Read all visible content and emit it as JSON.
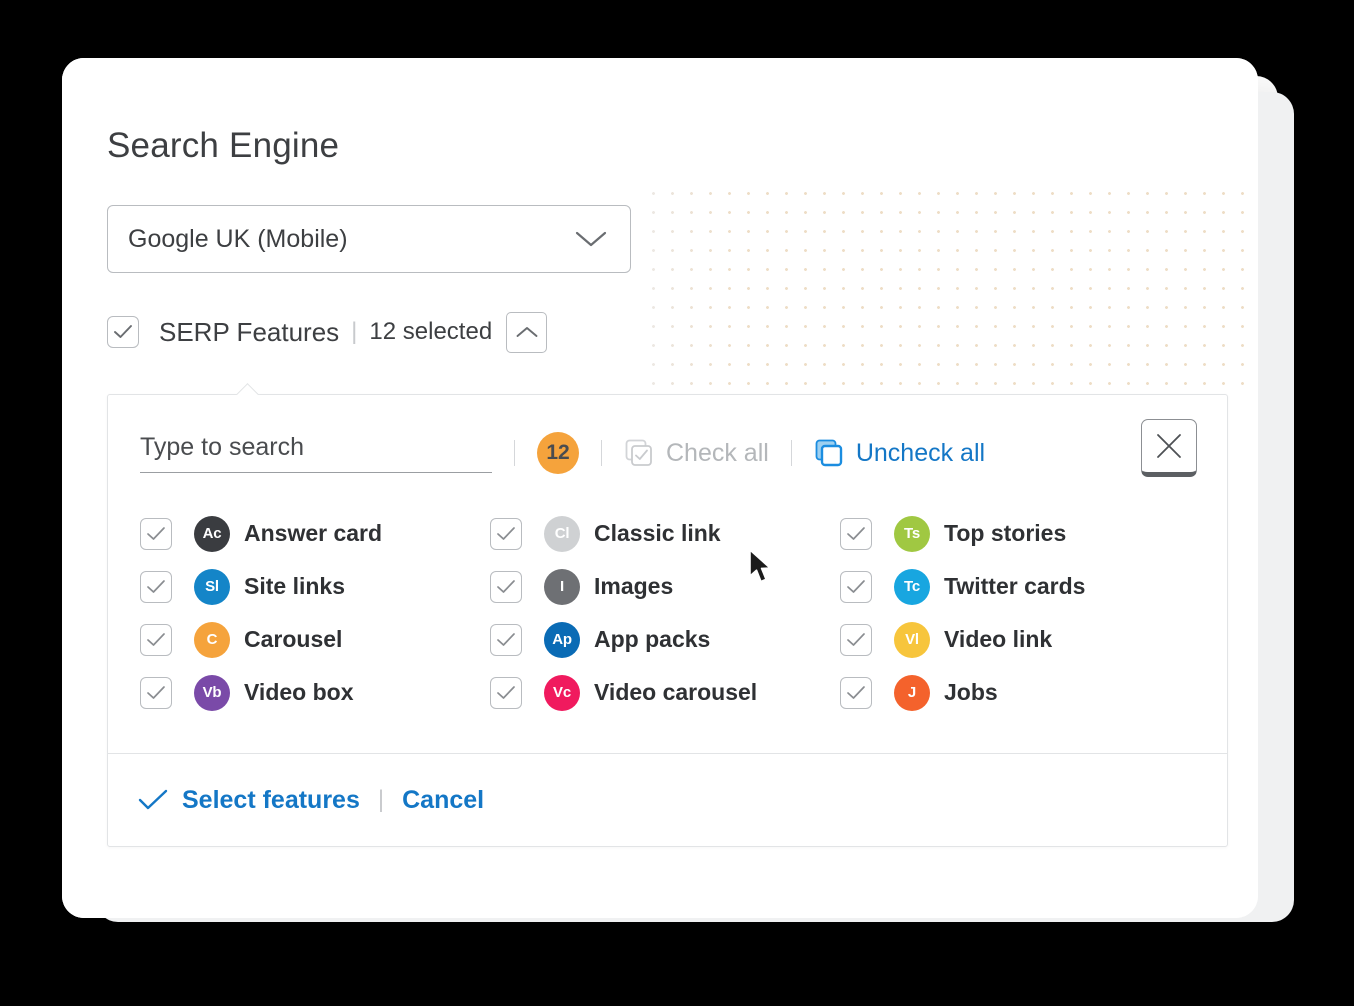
{
  "page_title": "Search Engine",
  "engine_select": {
    "value": "Google UK (Mobile)",
    "chevron_icon": "chevron-down-icon"
  },
  "serp_row": {
    "label": "SERP Features",
    "divider": "|",
    "count_text": "12 selected",
    "collapse_icon": "chevron-up-icon",
    "checked": true
  },
  "panel": {
    "search": {
      "placeholder": "Type to search",
      "value": ""
    },
    "selected_badge": "12",
    "check_all": {
      "label": "Check all",
      "icon": "stacked-checkbox-icon",
      "disabled": true
    },
    "uncheck_all": {
      "label": "Uncheck all",
      "icon": "stacked-empty-box-icon",
      "disabled": false
    },
    "close_button_icon": "close-x-icon",
    "divider": "|",
    "features": [
      {
        "label": "Answer card",
        "abbr": "Ac",
        "color": "#3a3c40",
        "checked": true
      },
      {
        "label": "Classic link",
        "abbr": "Cl",
        "color": "#cfd1d3",
        "checked": true
      },
      {
        "label": "Top stories",
        "abbr": "Ts",
        "color": "#a0c842",
        "checked": true
      },
      {
        "label": "Site links",
        "abbr": "Sl",
        "color": "#1485c8",
        "checked": true
      },
      {
        "label": "Images",
        "abbr": "I",
        "color": "#6e7074",
        "checked": true
      },
      {
        "label": "Twitter cards",
        "abbr": "Tc",
        "color": "#18a6e0",
        "checked": true
      },
      {
        "label": "Carousel",
        "abbr": "C",
        "color": "#f5a33c",
        "checked": true
      },
      {
        "label": "App packs",
        "abbr": "Ap",
        "color": "#0a6bb5",
        "checked": true
      },
      {
        "label": "Video link",
        "abbr": "Vl",
        "color": "#f7c53c",
        "checked": true
      },
      {
        "label": "Video box",
        "abbr": "Vb",
        "color": "#7a4aa8",
        "checked": true
      },
      {
        "label": "Video carousel",
        "abbr": "Vc",
        "color": "#f01a5e",
        "checked": true
      },
      {
        "label": "Jobs",
        "abbr": "J",
        "color": "#f4622c",
        "checked": true
      }
    ],
    "footer": {
      "submit_label": "Select features",
      "submit_icon": "check-icon",
      "divider": "|",
      "cancel_label": "Cancel"
    }
  },
  "colors": {
    "accent_blue": "#1477c6",
    "badge_orange": "#f5a33c",
    "text_dark": "#3d3f42",
    "disabled_grey": "#b4b7ba"
  }
}
